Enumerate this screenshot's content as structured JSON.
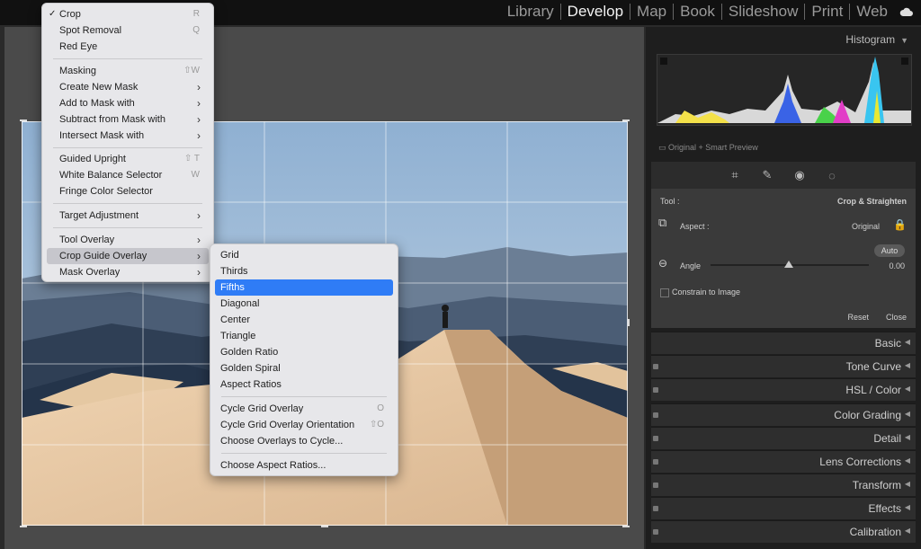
{
  "modules": [
    "Library",
    "Develop",
    "Map",
    "Book",
    "Slideshow",
    "Print",
    "Web"
  ],
  "active_module": "Develop",
  "histogram": {
    "title": "Histogram",
    "preview_label": "Original + Smart Preview"
  },
  "crop_panel": {
    "tool_label": "Tool :",
    "tool_name": "Crop & Straighten",
    "aspect_label": "Aspect :",
    "aspect_value": "Original",
    "auto_label": "Auto",
    "angle_label": "Angle",
    "angle_value": "0.00",
    "constrain_label": "Constrain to Image",
    "reset_label": "Reset",
    "close_label": "Close"
  },
  "sections": [
    "Basic",
    "Tone Curve",
    "HSL / Color",
    "Color Grading",
    "Detail",
    "Lens Corrections",
    "Transform",
    "Effects",
    "Calibration"
  ],
  "main_menu": [
    {
      "label": "Crop",
      "shortcut": "R",
      "checked": true
    },
    {
      "label": "Spot Removal",
      "shortcut": "Q"
    },
    {
      "label": "Red Eye",
      "shortcut": ""
    },
    {
      "label": "Masking",
      "shortcut": "⇧W"
    },
    {
      "label": "Create New Mask",
      "sub": true
    },
    {
      "label": "Add to Mask with",
      "sub": true
    },
    {
      "label": "Subtract from Mask with",
      "sub": true
    },
    {
      "label": "Intersect Mask with",
      "sub": true
    },
    {
      "label": "Guided Upright",
      "shortcut": "⇧ T"
    },
    {
      "label": "White Balance Selector",
      "shortcut": "W"
    },
    {
      "label": "Fringe Color Selector",
      "shortcut": ""
    },
    {
      "label": "Target Adjustment",
      "sub": true
    },
    {
      "label": "Tool Overlay",
      "sub": true
    },
    {
      "label": "Crop Guide Overlay",
      "sub": true
    },
    {
      "label": "Mask Overlay",
      "sub": true
    }
  ],
  "sub_menu": [
    {
      "label": "Grid"
    },
    {
      "label": "Thirds"
    },
    {
      "label": "Fifths"
    },
    {
      "label": "Diagonal"
    },
    {
      "label": "Center"
    },
    {
      "label": "Triangle"
    },
    {
      "label": "Golden Ratio"
    },
    {
      "label": "Golden Spiral"
    },
    {
      "label": "Aspect Ratios"
    },
    {
      "label": "Cycle Grid Overlay",
      "shortcut": "O"
    },
    {
      "label": "Cycle Grid Overlay Orientation",
      "shortcut": "⇧O"
    },
    {
      "label": "Choose Overlays to Cycle..."
    },
    {
      "label": "Choose Aspect Ratios..."
    }
  ],
  "colors": {
    "accent": "#2f7cf6",
    "menu_bg": "#e7e7ea",
    "panel_bg": "#1e1e1e"
  }
}
